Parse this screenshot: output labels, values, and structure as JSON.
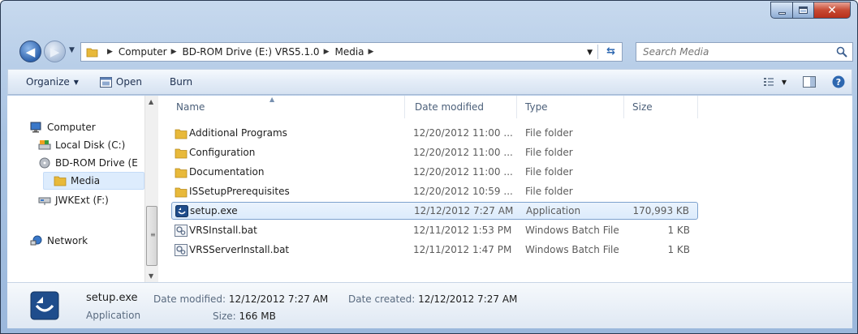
{
  "address": {
    "crumbs": [
      "Computer",
      "BD-ROM Drive (E:) VRS5.1.0",
      "Media"
    ]
  },
  "search": {
    "placeholder": "Search Media"
  },
  "toolbar": {
    "organize": "Organize",
    "open": "Open",
    "burn": "Burn"
  },
  "nav": {
    "computer": "Computer",
    "local_disk": "Local Disk (C:)",
    "bd_rom": "BD-ROM Drive (E",
    "media": "Media",
    "jwkext": "JWKExt (F:)",
    "network": "Network"
  },
  "columns": {
    "name": "Name",
    "date": "Date modified",
    "type": "Type",
    "size": "Size"
  },
  "files": [
    {
      "name": "Additional Programs",
      "date": "12/20/2012 11:00 ...",
      "type": "File folder",
      "size": "",
      "icon": "folder-icon"
    },
    {
      "name": "Configuration",
      "date": "12/20/2012 11:00 ...",
      "type": "File folder",
      "size": "",
      "icon": "folder-icon"
    },
    {
      "name": "Documentation",
      "date": "12/20/2012 11:00 ...",
      "type": "File folder",
      "size": "",
      "icon": "folder-icon"
    },
    {
      "name": "ISSetupPrerequisites",
      "date": "12/20/2012 10:59 ...",
      "type": "File folder",
      "size": "",
      "icon": "folder-icon"
    },
    {
      "name": "setup.exe",
      "date": "12/12/2012 7:27 AM",
      "type": "Application",
      "size": "170,993 KB",
      "icon": "setup-exe-icon"
    },
    {
      "name": "VRSInstall.bat",
      "date": "12/11/2012 1:53 PM",
      "type": "Windows Batch File",
      "size": "1 KB",
      "icon": "batch-file-icon"
    },
    {
      "name": "VRSServerInstall.bat",
      "date": "12/11/2012 1:47 PM",
      "type": "Windows Batch File",
      "size": "1 KB",
      "icon": "batch-file-icon"
    }
  ],
  "details": {
    "name": "setup.exe",
    "kind": "Application",
    "date_modified_label": "Date modified:",
    "date_modified": "12/12/2012 7:27 AM",
    "size_label": "Size:",
    "size": "166 MB",
    "date_created_label": "Date created:",
    "date_created": "12/12/2012 7:27 AM"
  },
  "colors": {
    "accent": "#2f63ad",
    "selection": "#dcebfc",
    "folder": "#e8b93a",
    "close_button": "#c74a33"
  }
}
